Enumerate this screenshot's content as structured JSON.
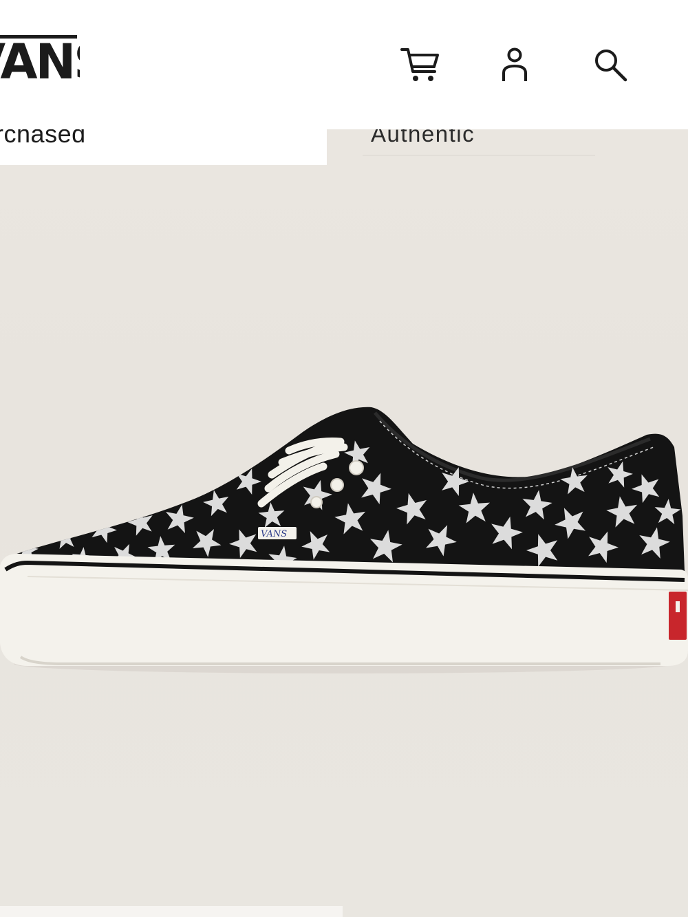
{
  "header": {
    "logo_text": "VANS",
    "icons": {
      "cart": "cart-icon",
      "account": "user-icon",
      "search": "search-icon"
    }
  },
  "subnav": {
    "left_text": "Purchased",
    "right_text": "Authentic"
  },
  "product": {
    "image_alt": "Authentic shoe, black canvas with white stars",
    "tongue_label": "VANS",
    "colors": {
      "background": "#e8e4de",
      "upper": "#141414",
      "stars": "#dcdcdc",
      "sole": "#f4f2ec",
      "heel_tab": "#c8262c"
    }
  }
}
